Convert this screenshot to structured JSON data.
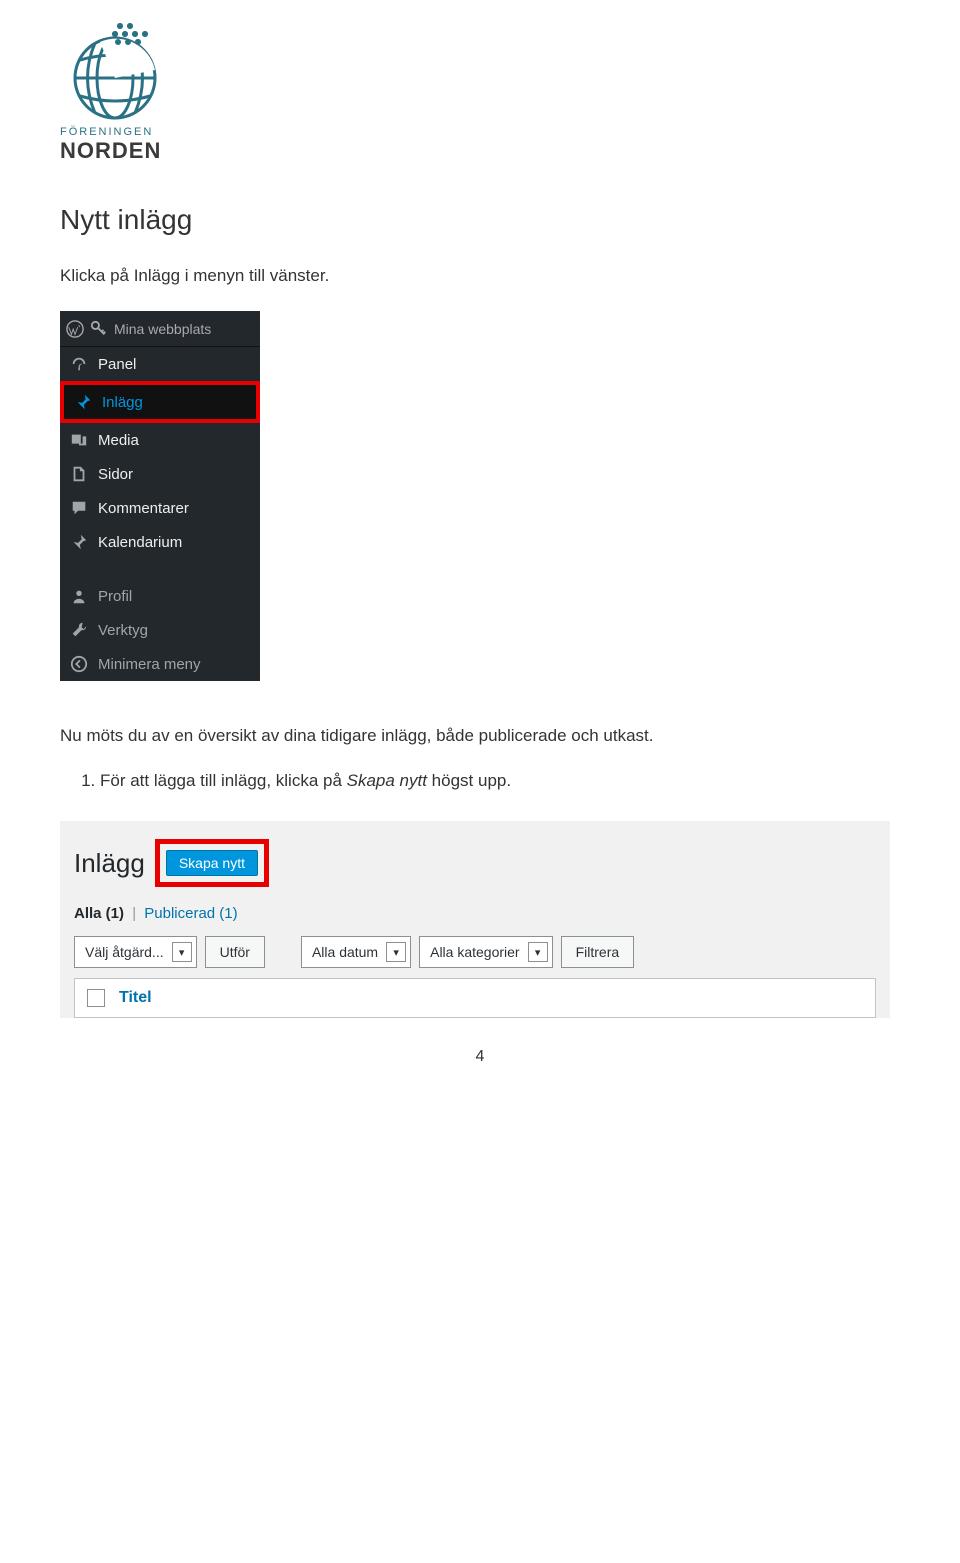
{
  "logo": {
    "line1": "FÖRENINGEN",
    "line2": "NORDEN"
  },
  "heading": "Nytt inlägg",
  "intro": "Klicka på Inlägg i menyn till vänster.",
  "sidebar": {
    "topbar_label": "Mina webbplats",
    "items": [
      {
        "label": "Panel"
      },
      {
        "label": "Inlägg"
      },
      {
        "label": "Media"
      },
      {
        "label": "Sidor"
      },
      {
        "label": "Kommentarer"
      },
      {
        "label": "Kalendarium"
      },
      {
        "label": "Profil"
      },
      {
        "label": "Verktyg"
      },
      {
        "label": "Minimera meny"
      }
    ]
  },
  "body_after_sidebar": "Nu möts du av en översikt av dina tidigare inlägg, både publicerade och utkast.",
  "step1": {
    "prefix": "För att lägga till inlägg, klicka på ",
    "em": "Skapa nytt",
    "suffix": " högst upp."
  },
  "posts": {
    "title": "Inlägg",
    "create_label": "Skapa nytt",
    "filters": {
      "all_label": "Alla (1)",
      "published_label": "Publicerad (1)"
    },
    "bulk_action_label": "Välj åtgärd...",
    "apply_label": "Utför",
    "date_filter_label": "Alla datum",
    "cat_filter_label": "Alla kategorier",
    "filter_btn_label": "Filtrera",
    "col_title": "Titel"
  },
  "page_number": "4"
}
